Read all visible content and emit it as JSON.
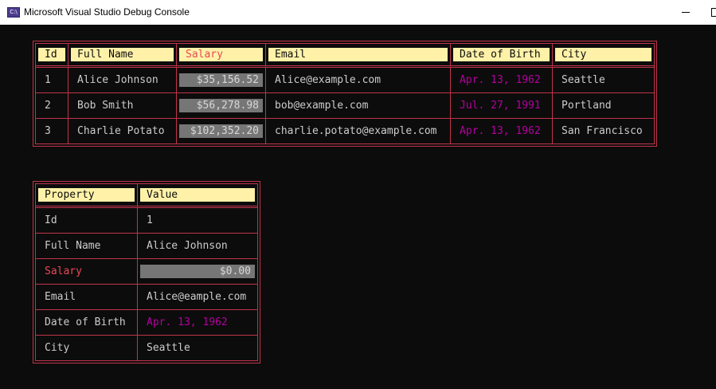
{
  "window": {
    "title": "Microsoft Visual Studio Debug Console",
    "icon": "C:\\"
  },
  "main_table": {
    "headers": [
      "Id",
      "Full Name",
      "Salary",
      "Email",
      "Date of Birth",
      "City"
    ],
    "rows": [
      [
        "1",
        "Alice Johnson",
        "$35,156.52",
        "Alice@example.com",
        "Apr. 13, 1962",
        "Seattle"
      ],
      [
        "2",
        "Bob Smith",
        "$56,278.98",
        "bob@example.com",
        "Jul. 27, 1991",
        "Portland"
      ],
      [
        "3",
        "Charlie Potato",
        "$102,352.20",
        "charlie.potato@example.com",
        "Apr. 13, 1962",
        "San Francisco"
      ]
    ]
  },
  "props_table": {
    "headers": [
      "Property",
      "Value"
    ],
    "rows": [
      [
        "Id",
        "1"
      ],
      [
        "Full Name",
        "Alice Johnson"
      ],
      [
        "Salary",
        "$0.00"
      ],
      [
        "Email",
        "Alice@eample.com"
      ],
      [
        "Date of Birth",
        "Apr. 13, 1962"
      ],
      [
        "City",
        "Seattle"
      ]
    ]
  },
  "colors": {
    "background": "#0c0c0c",
    "border": "#c0344c",
    "header_bg": "#fff2a8",
    "salary_red": "#e74856",
    "date_magenta": "#b4009e",
    "money_bg": "#767676"
  }
}
